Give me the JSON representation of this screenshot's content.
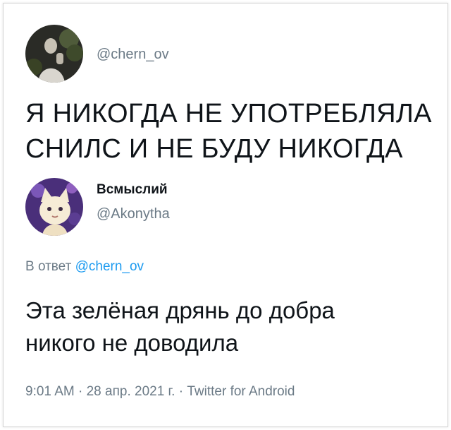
{
  "tweet": {
    "handle": "@chern_ov",
    "lines": [
      "Я НИКОГДА НЕ УПОТРЕБЛЯЛА",
      "СНИЛС И НЕ БУДУ НИКОГДА"
    ]
  },
  "reply": {
    "display_name": "Всмыслий",
    "handle": "@Akonytha",
    "in_reply_prefix": "В ответ",
    "in_reply_mention": "@chern_ov",
    "lines": [
      "Эта зелёная дрянь до добра",
      "никого не доводила"
    ],
    "meta": {
      "time": "9:01 AM",
      "date": "28 апр. 2021 г.",
      "source": "Twitter for Android",
      "separator": " · "
    }
  },
  "colors": {
    "text": "#0f1419",
    "secondary": "#6b7a86",
    "link": "#1d9bf0"
  },
  "icons": [
    "avatar-photo-chern-ov",
    "avatar-cat-akonytha"
  ]
}
